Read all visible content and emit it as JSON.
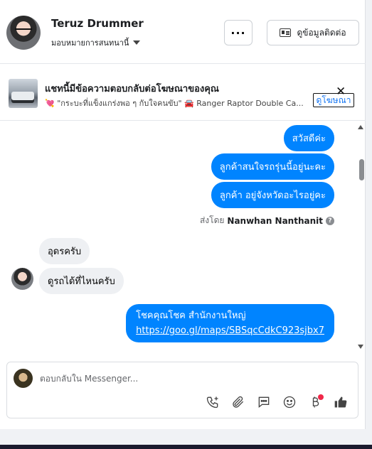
{
  "contact": {
    "name": "Teruz Drummer",
    "assign_label": "มอบหมายการสนทนานี้"
  },
  "header": {
    "more_label": "···",
    "contact_info_label": "ดูข้อมูลติดต่อ"
  },
  "ad_banner": {
    "title": "แชทนี้มีข้อความตอบกลับต่อโฆษณาของคุณ",
    "subtitle_prefix": "💘",
    "subtitle_quote": "\"กระบะที่แข็งแกร่งพอ ๆ กับใจคนขับ\"",
    "subtitle_car": "🚘",
    "subtitle_model": "Ranger Raptor Double Ca...",
    "view_ad_label": "ดูโฆษณา",
    "close_label": "✕"
  },
  "messages": [
    {
      "direction": "out",
      "text": "สวัสดีค่ะ"
    },
    {
      "direction": "out",
      "text": "ลูกค้าสนใจรถรุ่นนี้อยู่นะคะ"
    },
    {
      "direction": "out",
      "text": "ลูกค้า  อยู่จังหวัดอะไรอยู่คะ"
    },
    {
      "direction": "in",
      "text": "อุดรครับ"
    },
    {
      "direction": "in",
      "text": "ดูรถได้ที่ไหนครับ"
    },
    {
      "direction": "out",
      "text": "โชคคุณโชค สำนักงานใหญ่",
      "link": "https://goo.gl/maps/SBSqcCdkC923sjbx7"
    }
  ],
  "sent_by": {
    "prefix": "ส่งโดย",
    "agent": "Nanwhan Nanthanit",
    "info_icon": "?"
  },
  "composer": {
    "placeholder": "ตอบกลับใน Messenger...",
    "tools": [
      "call-add-icon",
      "attachment-icon",
      "saved-reply-icon",
      "emoji-icon",
      "payment-baht-icon",
      "like-icon"
    ]
  },
  "colors": {
    "outgoing_bubble": "#0084ff",
    "incoming_bubble": "#eef0f3",
    "accent": "#1877f2",
    "notification_dot": "#f02849"
  }
}
